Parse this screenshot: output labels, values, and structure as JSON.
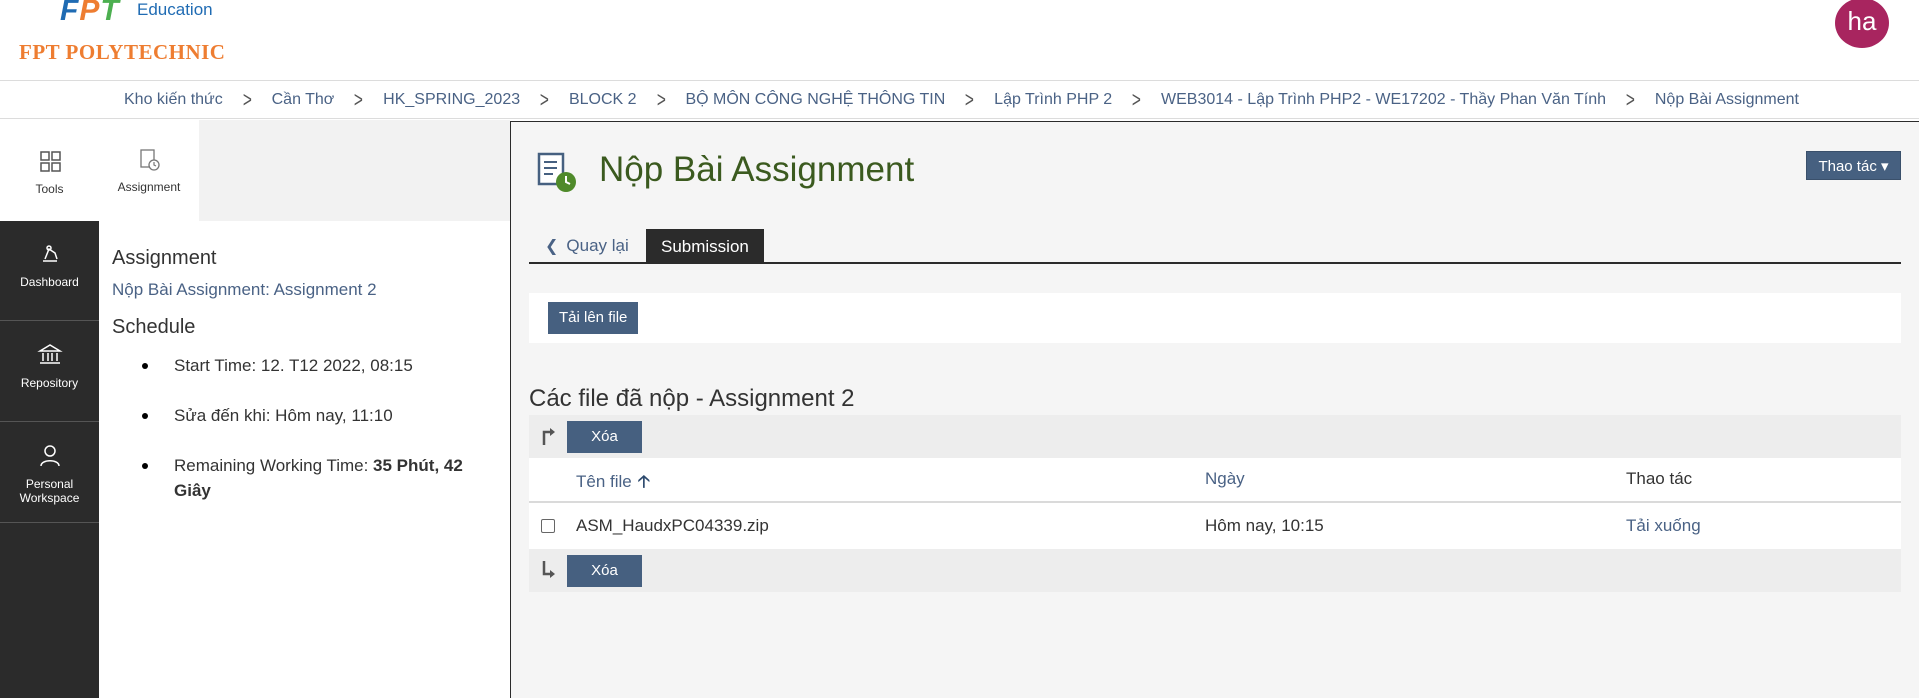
{
  "header": {
    "logo_fpt": "FPT",
    "logo_education": "Education",
    "logo_polytechnic": "FPT POLYTECHNIC",
    "avatar_initials": "ha",
    "colors": {
      "brand_orange": "#ee7d31",
      "avatar": "#a8255f"
    }
  },
  "breadcrumb": [
    "Kho kiến thức",
    "Cần Thơ",
    "HK_SPRING_2023",
    "BLOCK 2",
    "BỘ MÔN CÔNG NGHỆ THÔNG TIN",
    "Lập Trình PHP 2",
    "WEB3014 - Lập Trình PHP2 - WE17202 - Thầy Phan Văn Tính",
    "Nộp Bài Assignment"
  ],
  "nav": {
    "tools": "Tools",
    "dashboard": "Dashboard",
    "repository": "Repository",
    "personal_workspace_1": "Personal",
    "personal_workspace_2": "Workspace"
  },
  "subnav": {
    "assignment": "Assignment"
  },
  "side": {
    "heading": "Assignment",
    "link": "Nộp Bài Assignment: Assignment 2",
    "schedule_heading": "Schedule",
    "start_time": "Start Time: 12. T12 2022, 08:15",
    "edit_until": "Sửa đến khi: Hôm nay, 11:10",
    "remaining_label": "Remaining Working Time: ",
    "remaining_value": "35 Phút, 42 Giây"
  },
  "main": {
    "title": "Nộp Bài Assignment",
    "actions_button": "Thao tác ▾",
    "tab_back": "Quay lại",
    "tab_submission": "Submission",
    "upload_button": "Tải lên file",
    "files_title": "Các file đã nộp - Assignment 2",
    "delete_button": "Xóa",
    "columns": {
      "name": "Tên file",
      "date": "Ngày",
      "actions": "Thao tác"
    },
    "files": [
      {
        "name": "ASM_HaudxPC04339.zip",
        "date": "Hôm nay, 10:15",
        "action": "Tải xuống"
      }
    ]
  }
}
